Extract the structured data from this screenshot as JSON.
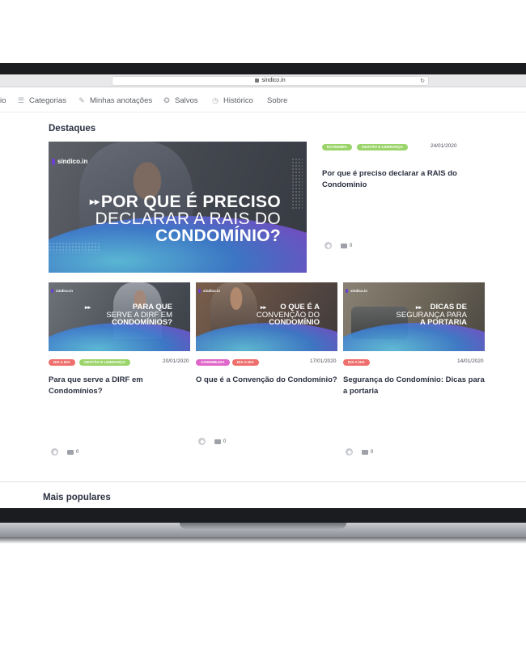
{
  "browser": {
    "url": "sindico.in"
  },
  "nav": {
    "items": [
      {
        "label": "io",
        "icon": ""
      },
      {
        "label": "Categorias",
        "icon": "list-icon"
      },
      {
        "label": "Minhas anotações",
        "icon": "pin-icon"
      },
      {
        "label": "Salvos",
        "icon": "star-icon"
      },
      {
        "label": "Histórico",
        "icon": "history-icon"
      },
      {
        "label": "Sobre",
        "icon": ""
      }
    ]
  },
  "highlights": {
    "title": "Destaques",
    "featured": {
      "image": {
        "brand": "sindico.in",
        "line1": "POR QUE É PRECISO",
        "line2": "DECLARAR A RAIS DO",
        "line3": "CONDOMÍNIO?"
      },
      "tags": [
        {
          "label": "ECONOMIA",
          "color": "#9bd46a"
        },
        {
          "label": "GESTÃO E LIDERANÇA",
          "color": "#9bd46a"
        }
      ],
      "date": "24/01/2020",
      "title": "Por que é preciso declarar a RAIS do Condomínio",
      "comments": "0"
    },
    "cards": [
      {
        "image": {
          "brand": "sindico.in",
          "line1": "PARA QUE",
          "line2": "SERVE A DIRF EM",
          "line3": "CONDOMÍNIOS?"
        },
        "tags": [
          {
            "label": "DIA A DIA",
            "color": "#ef6f6c"
          },
          {
            "label": "GESTÃO E LIDERANÇA",
            "color": "#9bd46a"
          }
        ],
        "date": "20/01/2020",
        "title": "Para que serve a DIRF em Condomínios?",
        "comments": "0"
      },
      {
        "image": {
          "brand": "sindico.in",
          "line1": "O QUE É A",
          "line2": "CONVENÇÃO DO",
          "line3": "CONDOMÍNIO"
        },
        "tags": [
          {
            "label": "ASSEMBLEIA",
            "color": "#e067c9"
          },
          {
            "label": "DIA A DIA",
            "color": "#ef6f6c"
          }
        ],
        "date": "17/01/2020",
        "title": "O que é a Convenção do Condomínio?",
        "comments": "0"
      },
      {
        "image": {
          "brand": "sindico.in",
          "line1": "DICAS DE",
          "line2": "SEGURANÇA PARA",
          "line3": "A PORTARIA"
        },
        "tags": [
          {
            "label": "DIA A DIA",
            "color": "#ef6f6c"
          }
        ],
        "date": "14/01/2020",
        "title": "Segurança do Condomínio: Dicas para a portaria",
        "comments": "0"
      }
    ]
  },
  "popular": {
    "title": "Mais populares"
  }
}
